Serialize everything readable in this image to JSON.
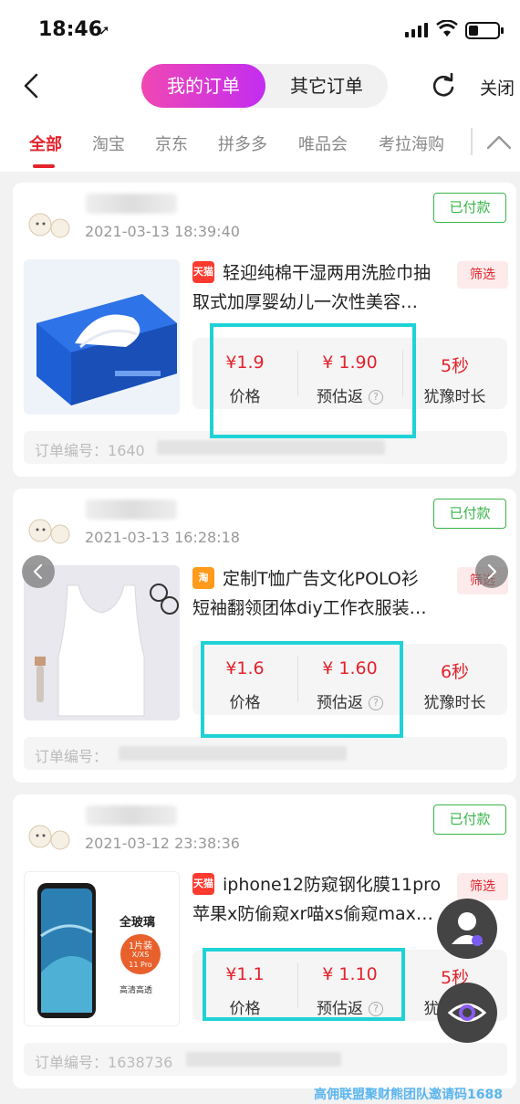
{
  "status_bar": {
    "time": "18:46",
    "location_glyph": "➚"
  },
  "header": {
    "tab_mine": "我的订单",
    "tab_other": "其它订单",
    "close": "关闭"
  },
  "platform_tabs": [
    {
      "label": "全部",
      "active": true
    },
    {
      "label": "淘宝",
      "active": false
    },
    {
      "label": "京东",
      "active": false
    },
    {
      "label": "拼多多",
      "active": false
    },
    {
      "label": "唯品会",
      "active": false
    },
    {
      "label": "考拉海购",
      "active": false
    }
  ],
  "orders": [
    {
      "date": "2021-03-13 18:39:40",
      "status": "已付款",
      "platform": "天猫",
      "title_line1": "轻迎纯棉干湿两用洗脸巾抽",
      "title_line2": "取式加厚婴幼儿一次性美容…",
      "filter": "筛选",
      "price": "¥1.9",
      "price_label": "价格",
      "rebate": "¥ 1.90",
      "rebate_label": "预估返",
      "hesitate": "5秒",
      "hesitate_label": "犹豫时长",
      "order_label": "订单编号：",
      "order_no_visible": "1640"
    },
    {
      "date": "2021-03-13 16:28:18",
      "status": "已付款",
      "platform": "淘",
      "title_line1": "定制T恤广告文化POLO衫",
      "title_line2": "短袖翻领团体diy工作衣服装…",
      "filter": "筛选",
      "price": "¥1.6",
      "price_label": "价格",
      "rebate": "¥ 1.60",
      "rebate_label": "预估返",
      "hesitate": "6秒",
      "hesitate_label": "犹豫时长",
      "order_label": "订单编号：",
      "order_no_visible": ""
    },
    {
      "date": "2021-03-12 23:38:36",
      "status": "已付款",
      "platform": "天猫",
      "title_line1": "iphone12防窥钢化膜11pro",
      "title_line2": "苹果x防偷窥xr喵xs偷窥max…",
      "filter": "筛选",
      "price": "¥1.1",
      "price_label": "价格",
      "rebate": "¥ 1.10",
      "rebate_label": "预估返",
      "hesitate": "5秒",
      "hesitate_label": "犹豫时长",
      "order_label": "订单编号：",
      "order_no_visible": "1638736"
    }
  ],
  "product3_image_text": {
    "line1": "全玻璃",
    "badge1": "1片装",
    "badge2": "X/XS",
    "badge3": "11 Pro",
    "line2": "高清高透"
  },
  "watermark": "高佣联盟聚财熊团队邀请码1688",
  "colors": {
    "accent_red": "#e3232c",
    "paid_green": "#39b54a",
    "highlight_cyan": "#1fd2d6",
    "tmall_red": "#ff3b30",
    "taobao_orange": "#ff6a00"
  }
}
